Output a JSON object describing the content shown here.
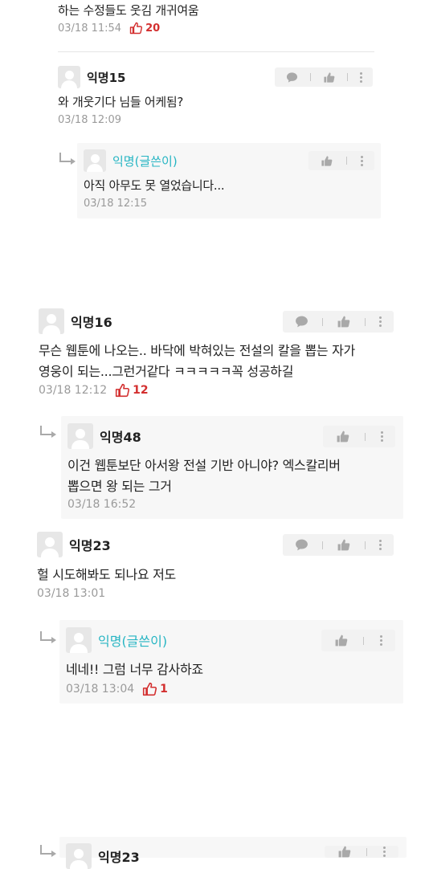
{
  "comments": [
    {
      "text": "하는 수정들도 웃김 개귀여움",
      "time": "03/18 11:54",
      "likes": "20"
    },
    {
      "nick": "익명15",
      "text": "와 개웃기다 님들 어케됨?",
      "time": "03/18 12:09",
      "replies": [
        {
          "nick": "익명(글쓴이)",
          "text": "아직 아무도 못 열었습니다...",
          "time": "03/18 12:15"
        }
      ]
    },
    {
      "nick": "익명16",
      "text_line1": "무슨 웹툰에 나오는.. 바닥에 박혀있는 전설의 칼을 뽑는 자가",
      "text_line2": "영웅이 되는...그런거같다 ㅋㅋㅋㅋㅋ꼭 성공하길",
      "time": "03/18 12:12",
      "likes": "12",
      "replies": [
        {
          "nick": "익명48",
          "text_line1": "이건 웹툰보단 아서왕 전설 기반 아니야? 엑스칼리버",
          "text_line2": "뽑으면 왕 되는 그거",
          "time": "03/18 16:52"
        }
      ]
    },
    {
      "nick": "익명23",
      "text": "헐 시도해봐도 되나요 저도",
      "time": "03/18 13:01",
      "replies": [
        {
          "nick": "익명(글쓴이)",
          "text": "네네!! 그럼 너무 감사하죠",
          "time": "03/18 13:04",
          "likes": "1"
        }
      ]
    },
    {
      "replies": [
        {
          "nick": "익명23"
        }
      ]
    }
  ],
  "icons": {
    "comment": "speech-bubble-icon",
    "like": "thumbs-up-icon",
    "more": "more-vertical-icon"
  },
  "colors": {
    "op_nick": "#26b5c3",
    "like_count": "#d32f2f",
    "reply_bg": "#f7f7f7"
  }
}
